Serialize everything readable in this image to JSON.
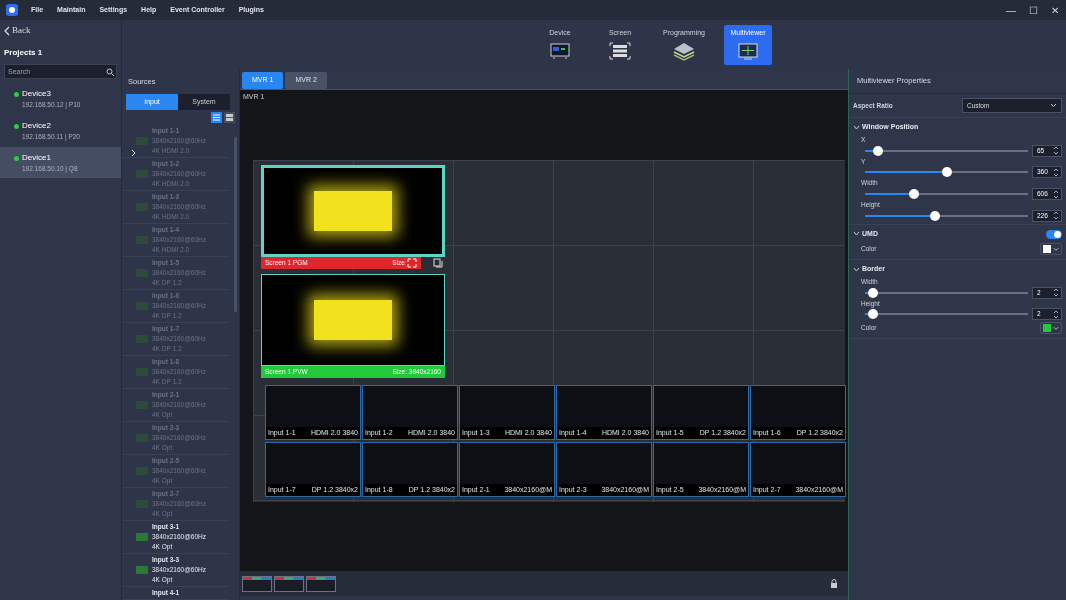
{
  "menu": [
    "File",
    "Maintain",
    "Settings",
    "Help",
    "Event Controller",
    "Plugins"
  ],
  "window_controls": [
    "—",
    "☐",
    "✕"
  ],
  "back": "Back",
  "project": {
    "title": "Projects 1",
    "search_placeholder": "Search"
  },
  "devices": [
    {
      "name": "Device3",
      "address": "192.168.50.12 | P10",
      "selected": false,
      "color": "#2ecc40"
    },
    {
      "name": "Device2",
      "address": "192.168.50.11 | P20",
      "selected": false,
      "color": "#2ecc40"
    },
    {
      "name": "Device1",
      "address": "192.168.50.10 | Q8",
      "selected": true,
      "color": "#2ecc40"
    }
  ],
  "modes": [
    {
      "label": "Device",
      "kind": "device",
      "selected": false
    },
    {
      "label": "Screen",
      "kind": "screen",
      "selected": false
    },
    {
      "label": "Programming",
      "kind": "layers",
      "selected": false
    },
    {
      "label": "Multiviewer",
      "kind": "multiviewer",
      "selected": true
    }
  ],
  "sources": {
    "title": "Sources",
    "tabs": [
      {
        "label": "Input",
        "selected": true
      },
      {
        "label": "System",
        "selected": false
      }
    ],
    "views": [
      {
        "kind": "list",
        "selected": true
      },
      {
        "kind": "grid",
        "selected": false
      }
    ],
    "items": [
      {
        "name": "Input 1-1",
        "resolution": "3840x2160@60Hz",
        "interface": "4K HDMI 2.0",
        "disabled": true
      },
      {
        "name": "Input 1-2",
        "resolution": "3840x2160@60Hz",
        "interface": "4K HDMI 2.0",
        "disabled": true
      },
      {
        "name": "Input 1-3",
        "resolution": "3840x2160@60Hz",
        "interface": "4K HDMI 2.0",
        "disabled": true
      },
      {
        "name": "Input 1-4",
        "resolution": "3840x2160@60Hz",
        "interface": "4K HDMI 2.0",
        "disabled": true
      },
      {
        "name": "Input 1-5",
        "resolution": "3840x2160@60Hz",
        "interface": "4K DP 1.2",
        "disabled": true
      },
      {
        "name": "Input 1-6",
        "resolution": "3840x2160@60Hz",
        "interface": "4K DP 1.2",
        "disabled": true
      },
      {
        "name": "Input 1-7",
        "resolution": "3840x2160@60Hz",
        "interface": "4K DP 1.2",
        "disabled": true
      },
      {
        "name": "Input 1-8",
        "resolution": "3840x2160@60Hz",
        "interface": "4K DP 1.2",
        "disabled": true
      },
      {
        "name": "Input 2-1",
        "resolution": "3840x2160@60Hz",
        "interface": "4K Opt",
        "disabled": true
      },
      {
        "name": "Input 2-3",
        "resolution": "3840x2160@60Hz",
        "interface": "4K Opt",
        "disabled": true
      },
      {
        "name": "Input 2-5",
        "resolution": "3840x2160@60Hz",
        "interface": "4K Opt",
        "disabled": true
      },
      {
        "name": "Input 2-7",
        "resolution": "3840x2160@60Hz",
        "interface": "4K Opt",
        "disabled": true
      },
      {
        "name": "Input 3-1",
        "resolution": "3840x2160@60Hz",
        "interface": "4K Opt",
        "disabled": false
      },
      {
        "name": "Input 3-3",
        "resolution": "3840x2160@60Hz",
        "interface": "4K Opt",
        "disabled": false
      },
      {
        "name": "Input 4-1",
        "disabled": false
      }
    ]
  },
  "mvr_tabs": [
    {
      "label": "MVR 1",
      "selected": true
    },
    {
      "label": "MVR 2",
      "selected": false
    }
  ],
  "canvas": {
    "title": "MVR 1",
    "screens": [
      {
        "kind": "pgm",
        "label": "Screen 1 PGM",
        "size": "Size"
      },
      {
        "kind": "pvw",
        "label": "Screen 1 PVW",
        "size": "Size: 3840x2160"
      }
    ],
    "inputs": [
      {
        "name": "Input 1-1",
        "info": "HDMI 2.0 3840"
      },
      {
        "name": "Input 1-2",
        "info": "HDMI 2.0 3840"
      },
      {
        "name": "Input 1-3",
        "info": "HDMI 2.0 3840"
      },
      {
        "name": "Input 1-4",
        "info": "HDMI 2.0 3840"
      },
      {
        "name": "Input 1-5",
        "info": "DP 1.2 3840x2"
      },
      {
        "name": "Input 1-6",
        "info": "DP 1.2 3840x2"
      },
      {
        "name": "Input 1-7",
        "info": "DP 1.2 3840x2"
      },
      {
        "name": "Input 1-8",
        "info": "DP 1.2 3840x2"
      },
      {
        "name": "Input 2-1",
        "info": "3840x2160@M"
      },
      {
        "name": "Input 2-3",
        "info": "3840x2160@M"
      },
      {
        "name": "Input 2-5",
        "info": "3840x2160@M"
      },
      {
        "name": "Input 2-7",
        "info": "3840x2160@M"
      }
    ]
  },
  "properties": {
    "title": "Multiviewer Properties",
    "aspect_ratio": {
      "label": "Aspect Ratio",
      "value": "Custom"
    },
    "sections": [
      {
        "title": "Window Position",
        "expanded": true,
        "rows": [
          {
            "kind": "slider",
            "label": "X",
            "level": 0.08,
            "value": "65"
          },
          {
            "kind": "slider",
            "label": "Y",
            "level": 0.5,
            "value": "360"
          },
          {
            "kind": "slider",
            "label": "Width",
            "level": 0.3,
            "value": "606"
          },
          {
            "kind": "slider",
            "label": "Height",
            "level": 0.43,
            "value": "226"
          }
        ]
      },
      {
        "title": "UMD",
        "expanded": true,
        "toggle": true,
        "rows": [
          {
            "kind": "color",
            "label": "Color",
            "color": "#ffffff"
          }
        ]
      },
      {
        "title": "Border",
        "expanded": true,
        "rows": [
          {
            "kind": "slider",
            "label": "Width",
            "level": 0.05,
            "value": "2"
          },
          {
            "kind": "slider",
            "label": "Height",
            "level": 0.05,
            "value": "2"
          },
          {
            "kind": "color",
            "label": "Color",
            "color": "#22c93a"
          }
        ]
      }
    ]
  }
}
